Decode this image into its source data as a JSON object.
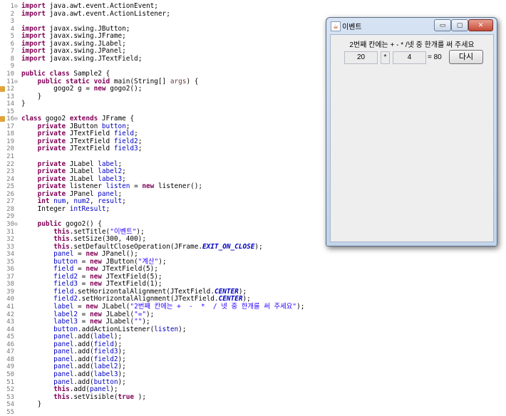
{
  "editor": {
    "lines": [
      {
        "n": "1",
        "fold": "⊖",
        "parts": [
          [
            "kw",
            "import"
          ],
          [
            "",
            "java.awt.event.ActionEvent;"
          ]
        ]
      },
      {
        "n": "2",
        "parts": [
          [
            "kw",
            "import"
          ],
          [
            "",
            "java.awt.event.ActionListener;"
          ]
        ]
      },
      {
        "n": "3",
        "parts": []
      },
      {
        "n": "4",
        "parts": [
          [
            "kw",
            "import"
          ],
          [
            "",
            "javax.swing.JButton;"
          ]
        ]
      },
      {
        "n": "5",
        "parts": [
          [
            "kw",
            "import"
          ],
          [
            "",
            "javax.swing.JFrame;"
          ]
        ]
      },
      {
        "n": "6",
        "parts": [
          [
            "kw",
            "import"
          ],
          [
            "",
            "javax.swing.JLabel;"
          ]
        ]
      },
      {
        "n": "7",
        "parts": [
          [
            "kw",
            "import"
          ],
          [
            "",
            "javax.swing.JPanel;"
          ]
        ]
      },
      {
        "n": "8",
        "parts": [
          [
            "kw",
            "import"
          ],
          [
            "",
            "javax.swing.JTextField;"
          ]
        ]
      },
      {
        "n": "9",
        "parts": []
      },
      {
        "n": "10",
        "parts": [
          [
            "kw",
            "public class"
          ],
          [
            "",
            "Sample2 {"
          ]
        ]
      },
      {
        "n": "11",
        "fold": "⊖",
        "parts": [
          [
            "",
            "    "
          ],
          [
            "kw",
            "public static void"
          ],
          [
            "",
            "main(String[] "
          ],
          [
            "arg",
            "args"
          ],
          [
            "",
            ") {"
          ]
        ]
      },
      {
        "n": "12",
        "marker": true,
        "parts": [
          [
            "",
            "        gogo2 "
          ],
          [
            "",
            "g"
          ],
          [
            "",
            " = "
          ],
          [
            "kw",
            "new"
          ],
          [
            "",
            " gogo2();"
          ]
        ]
      },
      {
        "n": "13",
        "parts": [
          [
            "",
            "    }"
          ]
        ]
      },
      {
        "n": "14",
        "parts": [
          [
            "",
            "}"
          ]
        ]
      },
      {
        "n": "15",
        "parts": []
      },
      {
        "n": "16",
        "fold": "⊖",
        "marker": true,
        "parts": [
          [
            "kw",
            "class"
          ],
          [
            "",
            "gogo2 "
          ],
          [
            "kw",
            "extends"
          ],
          [
            "",
            "JFrame {"
          ]
        ]
      },
      {
        "n": "17",
        "parts": [
          [
            "",
            "    "
          ],
          [
            "kw",
            "private"
          ],
          [
            "",
            " JButton "
          ],
          [
            "fld",
            "button"
          ],
          [
            "",
            ";"
          ]
        ]
      },
      {
        "n": "18",
        "parts": [
          [
            "",
            "    "
          ],
          [
            "kw",
            "private"
          ],
          [
            "",
            " JTextField "
          ],
          [
            "fld",
            "field"
          ],
          [
            "",
            ";"
          ]
        ]
      },
      {
        "n": "19",
        "parts": [
          [
            "",
            "    "
          ],
          [
            "kw",
            "private"
          ],
          [
            "",
            " JTextField "
          ],
          [
            "fld",
            "field2"
          ],
          [
            "",
            ";"
          ]
        ]
      },
      {
        "n": "20",
        "parts": [
          [
            "",
            "    "
          ],
          [
            "kw",
            "private"
          ],
          [
            "",
            " JTextField "
          ],
          [
            "fld",
            "field3"
          ],
          [
            "",
            ";"
          ]
        ]
      },
      {
        "n": "21",
        "parts": []
      },
      {
        "n": "22",
        "parts": [
          [
            "",
            "    "
          ],
          [
            "kw",
            "private"
          ],
          [
            "",
            " JLabel "
          ],
          [
            "fld",
            "label"
          ],
          [
            "",
            ";"
          ]
        ]
      },
      {
        "n": "23",
        "parts": [
          [
            "",
            "    "
          ],
          [
            "kw",
            "private"
          ],
          [
            "",
            " JLabel "
          ],
          [
            "fld",
            "label2"
          ],
          [
            "",
            ";"
          ]
        ]
      },
      {
        "n": "24",
        "parts": [
          [
            "",
            "    "
          ],
          [
            "kw",
            "private"
          ],
          [
            "",
            " JLabel "
          ],
          [
            "fld",
            "label3"
          ],
          [
            "",
            ";"
          ]
        ]
      },
      {
        "n": "25",
        "parts": [
          [
            "",
            "    "
          ],
          [
            "kw",
            "private"
          ],
          [
            "",
            " listener "
          ],
          [
            "fld",
            "listen"
          ],
          [
            "",
            " = "
          ],
          [
            "kw",
            "new"
          ],
          [
            "",
            " listener();"
          ]
        ]
      },
      {
        "n": "26",
        "parts": [
          [
            "",
            "    "
          ],
          [
            "kw",
            "private"
          ],
          [
            "",
            " JPanel "
          ],
          [
            "fld",
            "panel"
          ],
          [
            "",
            ";"
          ]
        ]
      },
      {
        "n": "27",
        "parts": [
          [
            "",
            "    "
          ],
          [
            "kw",
            "int"
          ],
          [
            " ",
            ""
          ],
          [
            "fld",
            "num"
          ],
          [
            "",
            ", "
          ],
          [
            "fld",
            "num2"
          ],
          [
            "",
            ", "
          ],
          [
            "fld",
            "result"
          ],
          [
            "",
            ";"
          ]
        ]
      },
      {
        "n": "28",
        "parts": [
          [
            "",
            "    Integer "
          ],
          [
            "fld",
            "intResult"
          ],
          [
            "",
            ";"
          ]
        ]
      },
      {
        "n": "29",
        "parts": []
      },
      {
        "n": "30",
        "fold": "⊖",
        "parts": [
          [
            "",
            "    "
          ],
          [
            "kw",
            "public"
          ],
          [
            "",
            " gogo2() {"
          ]
        ]
      },
      {
        "n": "31",
        "parts": [
          [
            "",
            "        "
          ],
          [
            "kw",
            "this"
          ],
          [
            "",
            ".setTitle("
          ],
          [
            "str",
            "\"이벤트\""
          ],
          [
            "",
            ");"
          ]
        ]
      },
      {
        "n": "32",
        "parts": [
          [
            "",
            "        "
          ],
          [
            "kw",
            "this"
          ],
          [
            "",
            ".setSize(300, 400);"
          ]
        ]
      },
      {
        "n": "33",
        "parts": [
          [
            "",
            "        "
          ],
          [
            "kw",
            "this"
          ],
          [
            "",
            ".setDefaultCloseOperation(JFrame."
          ],
          [
            "cst",
            "EXIT_ON_CLOSE"
          ],
          [
            "",
            ");"
          ]
        ]
      },
      {
        "n": "34",
        "parts": [
          [
            "",
            "        "
          ],
          [
            "fld",
            "panel"
          ],
          [
            "",
            " = "
          ],
          [
            "kw",
            "new"
          ],
          [
            "",
            " JPanel();"
          ]
        ]
      },
      {
        "n": "35",
        "parts": [
          [
            "",
            "        "
          ],
          [
            "fld",
            "button"
          ],
          [
            "",
            " = "
          ],
          [
            "kw",
            "new"
          ],
          [
            "",
            " JButton("
          ],
          [
            "str",
            "\"계산\""
          ],
          [
            "",
            ");"
          ]
        ]
      },
      {
        "n": "36",
        "parts": [
          [
            "",
            "        "
          ],
          [
            "fld",
            "field"
          ],
          [
            "",
            " = "
          ],
          [
            "kw",
            "new"
          ],
          [
            "",
            " JTextField(5);"
          ]
        ]
      },
      {
        "n": "37",
        "parts": [
          [
            "",
            "        "
          ],
          [
            "fld",
            "field2"
          ],
          [
            "",
            " = "
          ],
          [
            "kw",
            "new"
          ],
          [
            "",
            " JTextField(5);"
          ]
        ]
      },
      {
        "n": "38",
        "parts": [
          [
            "",
            "        "
          ],
          [
            "fld",
            "field3"
          ],
          [
            "",
            " = "
          ],
          [
            "kw",
            "new"
          ],
          [
            "",
            " JTextField(1);"
          ]
        ]
      },
      {
        "n": "39",
        "parts": [
          [
            "",
            "        "
          ],
          [
            "fld",
            "field"
          ],
          [
            "",
            ".setHorizontalAlignment(JTextField."
          ],
          [
            "cst",
            "CENTER"
          ],
          [
            "",
            ");"
          ]
        ]
      },
      {
        "n": "40",
        "parts": [
          [
            "",
            "        "
          ],
          [
            "fld",
            "field2"
          ],
          [
            "",
            ".setHorizontalAlignment(JTextField."
          ],
          [
            "cst",
            "CENTER"
          ],
          [
            "",
            ");"
          ]
        ]
      },
      {
        "n": "41",
        "parts": [
          [
            "",
            "        "
          ],
          [
            "fld",
            "label"
          ],
          [
            "",
            " = "
          ],
          [
            "kw",
            "new"
          ],
          [
            "",
            " JLabel("
          ],
          [
            "str",
            "\"2번째 칸에는 +  -  *  / 넷 중 한개를 써 주세요\""
          ],
          [
            "",
            ");"
          ]
        ]
      },
      {
        "n": "42",
        "parts": [
          [
            "",
            "        "
          ],
          [
            "fld",
            "label2"
          ],
          [
            "",
            " = "
          ],
          [
            "kw",
            "new"
          ],
          [
            "",
            " JLabel("
          ],
          [
            "str",
            "\"=\""
          ],
          [
            "",
            ");"
          ]
        ]
      },
      {
        "n": "43",
        "parts": [
          [
            "",
            "        "
          ],
          [
            "fld",
            "label3"
          ],
          [
            "",
            " = "
          ],
          [
            "kw",
            "new"
          ],
          [
            "",
            " JLabel("
          ],
          [
            "str",
            "\"\""
          ],
          [
            "",
            ");"
          ]
        ]
      },
      {
        "n": "44",
        "parts": [
          [
            "",
            "        "
          ],
          [
            "fld",
            "button"
          ],
          [
            "",
            ".addActionListener("
          ],
          [
            "fld",
            "listen"
          ],
          [
            "",
            ");"
          ]
        ]
      },
      {
        "n": "45",
        "parts": [
          [
            "",
            "        "
          ],
          [
            "fld",
            "panel"
          ],
          [
            "",
            ".add("
          ],
          [
            "fld",
            "label"
          ],
          [
            "",
            ");"
          ]
        ]
      },
      {
        "n": "46",
        "parts": [
          [
            "",
            "        "
          ],
          [
            "fld",
            "panel"
          ],
          [
            "",
            ".add("
          ],
          [
            "fld",
            "field"
          ],
          [
            "",
            ");"
          ]
        ]
      },
      {
        "n": "47",
        "parts": [
          [
            "",
            "        "
          ],
          [
            "fld",
            "panel"
          ],
          [
            "",
            ".add("
          ],
          [
            "fld",
            "field3"
          ],
          [
            "",
            ");"
          ]
        ]
      },
      {
        "n": "48",
        "parts": [
          [
            "",
            "        "
          ],
          [
            "fld",
            "panel"
          ],
          [
            "",
            ".add("
          ],
          [
            "fld",
            "field2"
          ],
          [
            "",
            ");"
          ]
        ]
      },
      {
        "n": "49",
        "parts": [
          [
            "",
            "        "
          ],
          [
            "fld",
            "panel"
          ],
          [
            "",
            ".add("
          ],
          [
            "fld",
            "label2"
          ],
          [
            "",
            ");"
          ]
        ]
      },
      {
        "n": "50",
        "parts": [
          [
            "",
            "        "
          ],
          [
            "fld",
            "panel"
          ],
          [
            "",
            ".add("
          ],
          [
            "fld",
            "label3"
          ],
          [
            "",
            ");"
          ]
        ]
      },
      {
        "n": "51",
        "parts": [
          [
            "",
            "        "
          ],
          [
            "fld",
            "panel"
          ],
          [
            "",
            ".add("
          ],
          [
            "fld",
            "button"
          ],
          [
            "",
            ");"
          ]
        ]
      },
      {
        "n": "52",
        "parts": [
          [
            "",
            "        "
          ],
          [
            "kw",
            "this"
          ],
          [
            "",
            ".add("
          ],
          [
            "fld",
            "panel"
          ],
          [
            "",
            ");"
          ]
        ]
      },
      {
        "n": "53",
        "parts": [
          [
            "",
            "        "
          ],
          [
            "kw",
            "this"
          ],
          [
            "",
            ".setVisible("
          ],
          [
            "kw",
            "true"
          ],
          [
            "",
            ");"
          ]
        ]
      },
      {
        "n": "54",
        "parts": [
          [
            "",
            "    }"
          ]
        ]
      },
      {
        "n": "55",
        "parts": []
      }
    ]
  },
  "window": {
    "title": "이벤트",
    "title_icon": "java-icon",
    "minimize_label": "▭",
    "maximize_label": "▢",
    "close_label": "✕",
    "instruction": "2번째 칸에는 + - * /넷 중 한개를 써 주세요",
    "field1_value": "20",
    "operator_value": "*",
    "field2_value": "4",
    "result_text": "= 80",
    "again_label": "다시"
  }
}
